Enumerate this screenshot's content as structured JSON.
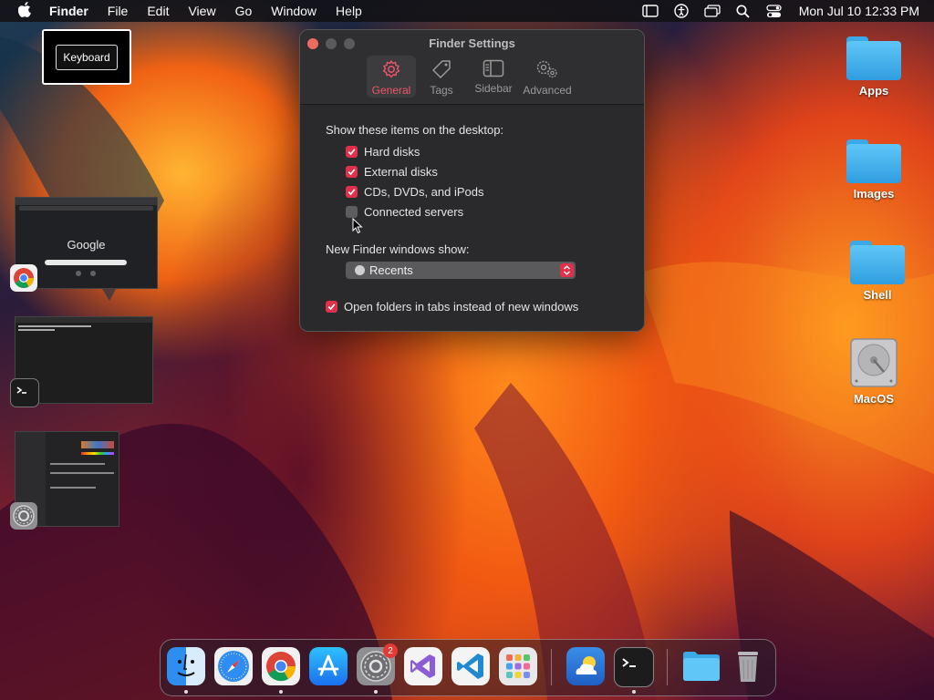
{
  "menubar": {
    "app_name": "Finder",
    "menus": [
      "File",
      "Edit",
      "View",
      "Go",
      "Window",
      "Help"
    ],
    "clock": "Mon Jul 10  12:33 PM"
  },
  "keyboard_popup": {
    "label": "Keyboard"
  },
  "finder_settings": {
    "title": "Finder Settings",
    "tabs": [
      {
        "label": "General",
        "icon": "gear-icon",
        "active": true
      },
      {
        "label": "Tags",
        "icon": "tag-icon",
        "active": false
      },
      {
        "label": "Sidebar",
        "icon": "sidebar-icon",
        "active": false
      },
      {
        "label": "Advanced",
        "icon": "gears-icon",
        "active": false
      }
    ],
    "desktop_section_label": "Show these items on the desktop:",
    "desktop_items": [
      {
        "label": "Hard disks",
        "checked": true
      },
      {
        "label": "External disks",
        "checked": true
      },
      {
        "label": "CDs, DVDs, and iPods",
        "checked": true
      },
      {
        "label": "Connected servers",
        "checked": false
      }
    ],
    "new_window_label": "New Finder windows show:",
    "new_window_value": "Recents",
    "open_in_tabs": {
      "label": "Open folders in tabs instead of new windows",
      "checked": true
    }
  },
  "desktop_icons": [
    {
      "label": "Apps",
      "type": "folder"
    },
    {
      "label": "Images",
      "type": "folder"
    },
    {
      "label": "Shell",
      "type": "folder"
    },
    {
      "label": "MacOS",
      "type": "hard-drive"
    }
  ],
  "stage_thumbnails": {
    "chrome": {
      "logo_text": "Google"
    }
  },
  "dock": {
    "apps": [
      "Finder",
      "Safari",
      "Google Chrome",
      "App Store",
      "System Settings",
      "Visual Studio",
      "Visual Studio Code",
      "Launchpad",
      "Weather",
      "Terminal",
      "Downloads folder",
      "Trash"
    ],
    "settings_badge": "2"
  },
  "colors": {
    "accent": "#e0304a",
    "window_bg": "#2a2a2c",
    "menubar_bg": "#141418"
  }
}
